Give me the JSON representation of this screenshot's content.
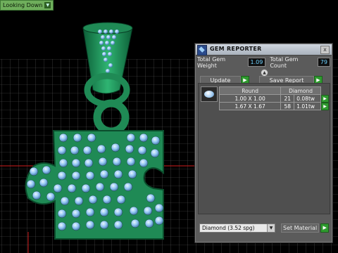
{
  "viewport": {
    "view_label": "Looking Down",
    "grid_color": "#6a6a6a",
    "axis_color": "#d21b1b"
  },
  "gem_reporter": {
    "title": "GEM REPORTER",
    "close_label": "x",
    "total_gem_weight_label": "Total Gem Weight",
    "total_gem_weight_value": "1.09",
    "total_gem_count_label": "Total Gem Count",
    "total_gem_count_value": "79",
    "update_label": "Update",
    "save_report_label": "Save Report",
    "table": {
      "headers": [
        "Round",
        "Diamond"
      ],
      "rows": [
        {
          "size": "1.00 X 1.00",
          "count": "21",
          "weight": "0.08tw"
        },
        {
          "size": "1.67 X 1.67",
          "count": "58",
          "weight": "1.01tw"
        }
      ]
    },
    "material_value": "Diamond    (3.52 spg)",
    "set_material_label": "Set Material"
  },
  "colors": {
    "metal_green": "#1f8a55",
    "gem_blue": "#8fc4f2",
    "panel_bg": "#5b5b5b",
    "accent_green": "#2f9a2f"
  }
}
